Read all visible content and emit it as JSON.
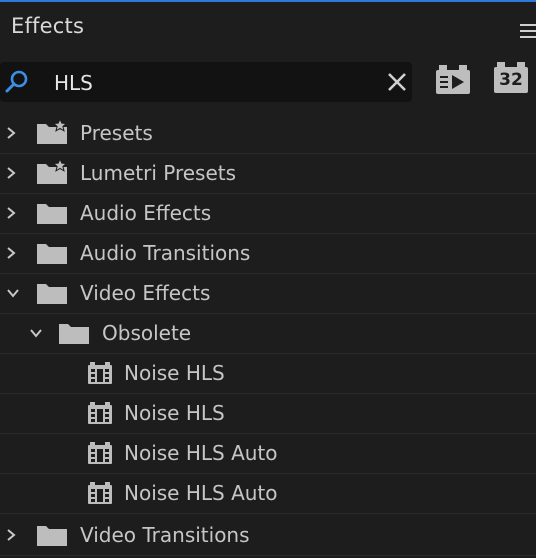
{
  "panel": {
    "title": "Effects"
  },
  "search": {
    "value": "HLS"
  },
  "toolbar": {
    "bit_depth_label": "32"
  },
  "tree": {
    "presets": "Presets",
    "lumetri_presets": "Lumetri Presets",
    "audio_effects": "Audio Effects",
    "audio_transitions": "Audio Transitions",
    "video_effects": "Video Effects",
    "obsolete": "Obsolete",
    "effects": [
      "Noise HLS",
      "Noise HLS",
      "Noise HLS Auto",
      "Noise HLS Auto"
    ],
    "video_transitions": "Video Transitions"
  },
  "colors": {
    "accent": "#2f7ad8",
    "background": "#1d1d1d",
    "text": "#c6c6c6"
  }
}
